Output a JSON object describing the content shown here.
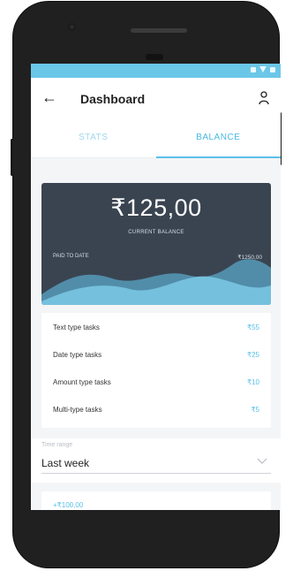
{
  "appbar": {
    "title": "Dashboard"
  },
  "tabs": [
    {
      "label": "STATS",
      "active": false
    },
    {
      "label": "BALANCE",
      "active": true
    }
  ],
  "balance": {
    "amount": "₹125,00",
    "current_label": "CURRENT BALANCE",
    "paid_label": "PAID TO DATE",
    "paid_value": "₹1250,00"
  },
  "tasks": [
    {
      "label": "Text type tasks",
      "value": "₹55"
    },
    {
      "label": "Date type tasks",
      "value": "₹25"
    },
    {
      "label": "Amount type tasks",
      "value": "₹10"
    },
    {
      "label": "Multi-type tasks",
      "value": "₹5"
    }
  ],
  "time_range": {
    "label": "Time range",
    "value": "Last week"
  },
  "earning": {
    "value": "+₹100,00"
  },
  "colors": {
    "accent": "#5bc0ea",
    "statusbar": "#6bc7e8",
    "card": "#3a4451"
  },
  "icons": {
    "back": "arrow-left-icon",
    "profile": "person-icon",
    "dropdown": "chevron-down-icon"
  }
}
